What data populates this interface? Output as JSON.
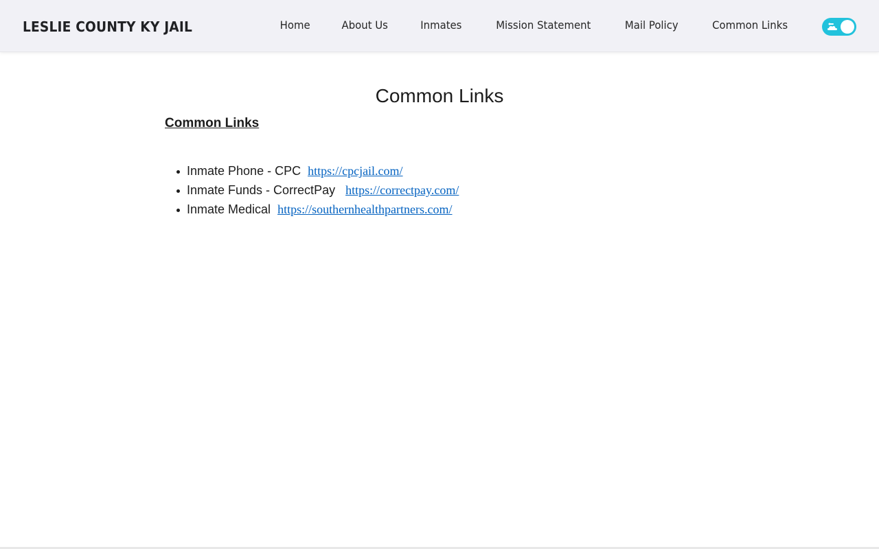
{
  "header": {
    "brand": "LESLIE COUNTY KY JAIL",
    "nav": [
      {
        "label": "Home"
      },
      {
        "label": "About Us"
      },
      {
        "label": "Inmates"
      },
      {
        "label": "Mission Statement"
      },
      {
        "label": "Mail Policy"
      },
      {
        "label": "Common Links"
      }
    ],
    "theme_toggle": {
      "state": "on",
      "icon": "cloud-icon",
      "accent": "#22c2dc"
    }
  },
  "main": {
    "title": "Common Links",
    "section_heading": "Common Links",
    "links": [
      {
        "label": "Inmate Phone - CPC",
        "url": "https://cpcjail.com/"
      },
      {
        "label": "Inmate Funds - CorrectPay",
        "url": "https://correctpay.com/"
      },
      {
        "label": "Inmate Medical",
        "url": "https://southernhealthpartners.com/"
      }
    ]
  },
  "colors": {
    "navbar_bg": "#f1f1f6",
    "link": "#0563c1",
    "text": "#1c1c1c"
  }
}
